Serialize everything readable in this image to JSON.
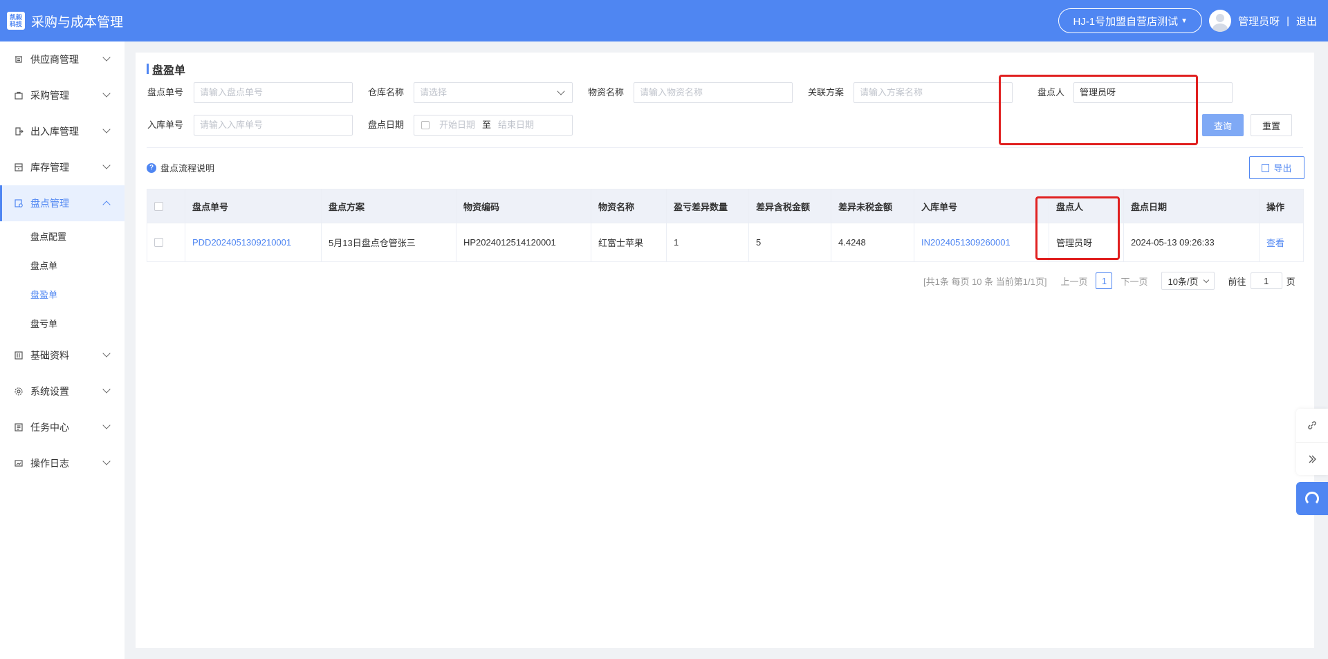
{
  "header": {
    "logo_line1": "凯毅",
    "logo_line2": "科技",
    "app_title": "采购与成本管理",
    "store": "HJ-1号加盟自营店测试",
    "user": "管理员呀",
    "separator": "|",
    "logout": "退出"
  },
  "sidebar": {
    "items": [
      {
        "label": "供应商管理",
        "icon": "supplier-icon"
      },
      {
        "label": "采购管理",
        "icon": "purchase-icon"
      },
      {
        "label": "出入库管理",
        "icon": "inout-icon"
      },
      {
        "label": "库存管理",
        "icon": "inventory-icon"
      },
      {
        "label": "盘点管理",
        "icon": "stocktake-icon",
        "expanded": true
      },
      {
        "label": "基础资料",
        "icon": "basic-data-icon"
      },
      {
        "label": "系统设置",
        "icon": "settings-icon"
      },
      {
        "label": "任务中心",
        "icon": "task-icon"
      },
      {
        "label": "操作日志",
        "icon": "log-icon"
      }
    ],
    "sub_items": [
      "盘点配置",
      "盘点单",
      "盘盈单",
      "盘亏单"
    ],
    "active_sub": "盘盈单"
  },
  "page": {
    "title": "盘盈单"
  },
  "filters": {
    "stocktake_no_label": "盘点单号",
    "stocktake_no_placeholder": "请输入盘点单号",
    "warehouse_label": "仓库名称",
    "warehouse_placeholder": "请选择",
    "material_label": "物资名称",
    "material_placeholder": "请输入物资名称",
    "plan_label": "关联方案",
    "plan_placeholder": "请输入方案名称",
    "counter_label": "盘点人",
    "counter_value": "管理员呀",
    "inbound_no_label": "入库单号",
    "inbound_no_placeholder": "请输入入库单号",
    "date_label": "盘点日期",
    "date_start_placeholder": "开始日期",
    "date_to": "至",
    "date_end_placeholder": "结束日期",
    "query_button": "查询",
    "reset_button": "重置"
  },
  "toolbar": {
    "help_text": "盘点流程说明",
    "help_mark": "?",
    "export_button": "导出"
  },
  "table": {
    "columns": [
      "盘点单号",
      "盘点方案",
      "物资编码",
      "物资名称",
      "盈亏差异数量",
      "差异含税金额",
      "差异未税金额",
      "入库单号",
      "盘点人",
      "盘点日期",
      "操作"
    ],
    "rows": [
      {
        "stocktake_no": "PDD2024051309210001",
        "plan": "5月13日盘点仓管张三",
        "material_code": "HP2024012514120001",
        "material_name": "红富士苹果",
        "diff_qty": "1",
        "diff_tax_amount": "5",
        "diff_untaxed_amount": "4.4248",
        "inbound_no": "IN2024051309260001",
        "counter": "管理员呀",
        "date": "2024-05-13 09:26:33",
        "action": "查看"
      }
    ]
  },
  "pagination": {
    "summary": "[共1条 每页 10 条 当前第1/1页]",
    "prev": "上一页",
    "current": "1",
    "next": "下一页",
    "page_size": "10条/页",
    "goto_label": "前往",
    "goto_value": "1",
    "goto_suffix": "页"
  },
  "colors": {
    "primary": "#4f86f2",
    "highlight": "#e02020"
  }
}
